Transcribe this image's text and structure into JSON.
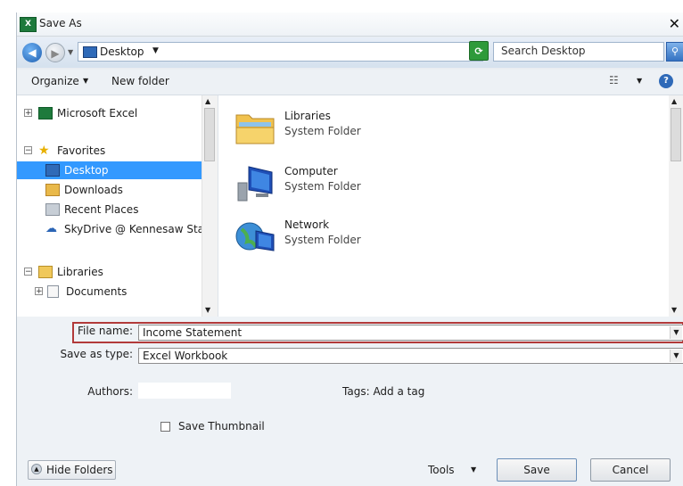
{
  "window": {
    "title": "Save As",
    "close_glyph": "✕",
    "app_icon_text": "X"
  },
  "address": {
    "path_label": "Desktop",
    "search_placeholder": "Search Desktop"
  },
  "toolbar": {
    "organize_label": "Organize",
    "new_folder_label": "New folder"
  },
  "nav": {
    "items": [
      {
        "label": "Microsoft Excel",
        "icon": "excel-icon",
        "expander": "+"
      },
      {
        "label": "Favorites",
        "icon": "star-icon",
        "expander": "−"
      },
      {
        "label": "Desktop",
        "icon": "desktop-icon",
        "selected": true
      },
      {
        "label": "Downloads",
        "icon": "downloads-icon"
      },
      {
        "label": "Recent Places",
        "icon": "recent-places-icon"
      },
      {
        "label": "SkyDrive @ Kennesaw Stat",
        "icon": "skydrive-icon"
      },
      {
        "label": "Libraries",
        "icon": "libraries-icon",
        "expander": "−"
      },
      {
        "label": "Documents",
        "icon": "documents-icon",
        "expander": "+"
      }
    ]
  },
  "files": [
    {
      "name": "Libraries",
      "type": "System Folder",
      "icon": "libraries-folder-icon"
    },
    {
      "name": "Computer",
      "type": "System Folder",
      "icon": "computer-icon"
    },
    {
      "name": "Network",
      "type": "System Folder",
      "icon": "network-icon"
    }
  ],
  "form": {
    "file_name_label": "File name:",
    "file_name_value": "Income Statement",
    "save_type_label": "Save as type:",
    "save_type_value": "Excel Workbook",
    "authors_label": "Authors:",
    "tags_label": "Tags:",
    "tags_value": "Add a tag",
    "thumbnail_label": "Save Thumbnail",
    "thumbnail_checked": false
  },
  "buttons": {
    "hide_folders": "Hide Folders",
    "tools": "Tools",
    "save": "Save",
    "cancel": "Cancel"
  }
}
